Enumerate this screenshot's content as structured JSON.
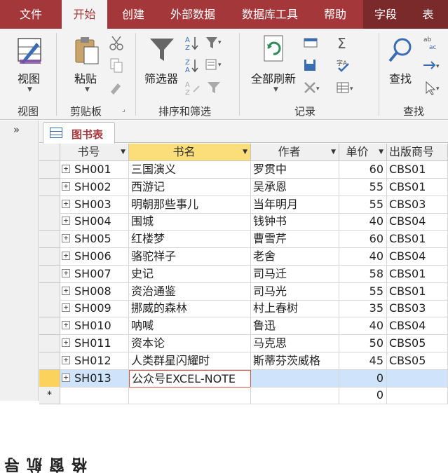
{
  "ribbon_tabs": [
    "文件",
    "开始",
    "创建",
    "外部数据",
    "数据库工具",
    "帮助",
    "字段",
    "表"
  ],
  "active_tab": "开始",
  "groups": {
    "view": {
      "label": "视图",
      "button": "视图"
    },
    "clipboard": {
      "label": "剪贴板",
      "button": "粘贴"
    },
    "sort_filter": {
      "label": "排序和筛选",
      "button": "筛选器"
    },
    "records": {
      "label": "记录",
      "button": "全部刷新"
    },
    "find": {
      "label": "查找",
      "button": "查找"
    }
  },
  "nav_pane": {
    "label": "导航窗格",
    "chevron": "»"
  },
  "doc_tab": {
    "title": "图书表",
    "icon": "table-icon"
  },
  "grid": {
    "columns": [
      "书号",
      "书名",
      "作者",
      "单价",
      "出版商号"
    ],
    "rows": [
      [
        "SH001",
        "三国演义",
        "罗贯中",
        "60",
        "CBS01"
      ],
      [
        "SH002",
        "西游记",
        "吴承恩",
        "55",
        "CBS01"
      ],
      [
        "SH003",
        "明朝那些事儿",
        "当年明月",
        "55",
        "CBS03"
      ],
      [
        "SH004",
        "围城",
        "钱钟书",
        "40",
        "CBS04"
      ],
      [
        "SH005",
        "红楼梦",
        "曹雪芹",
        "60",
        "CBS01"
      ],
      [
        "SH006",
        "骆驼祥子",
        "老舍",
        "40",
        "CBS04"
      ],
      [
        "SH007",
        "史记",
        "司马迁",
        "58",
        "CBS01"
      ],
      [
        "SH008",
        "资治通鉴",
        "司马光",
        "55",
        "CBS01"
      ],
      [
        "SH009",
        "挪威的森林",
        "村上春树",
        "35",
        "CBS03"
      ],
      [
        "SH010",
        "呐喊",
        "鲁迅",
        "40",
        "CBS04"
      ],
      [
        "SH011",
        "资本论",
        "马克思",
        "50",
        "CBS05"
      ],
      [
        "SH012",
        "人类群星闪耀时",
        "斯蒂芬茨威格",
        "45",
        "CBS05"
      ],
      [
        "SH013",
        "公众号EXCEL-NOTE",
        "",
        "0",
        ""
      ]
    ],
    "new_row": {
      "marker": "*",
      "price": "0"
    },
    "expand_glyph": "+"
  },
  "colors": {
    "accent": "#a4373a",
    "selected_header": "#fbde7a",
    "current_row": "#cfe4fb"
  }
}
